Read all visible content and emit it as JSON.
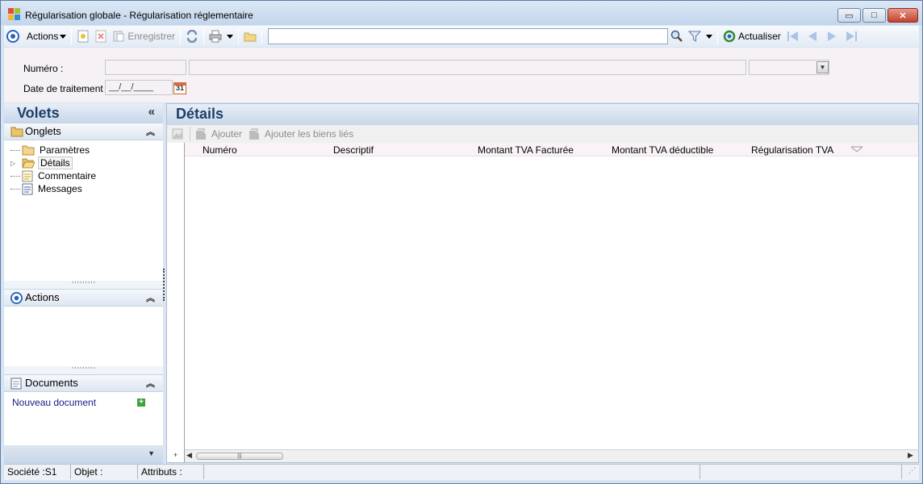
{
  "window": {
    "title": "Régularisation globale - Régularisation réglementaire",
    "controls": {
      "minimize": "▭",
      "maximize": "□",
      "close": "✕"
    }
  },
  "toolbar": {
    "actions_label": "Actions",
    "save_label": "Enregistrer",
    "search_placeholder": "",
    "refresh_label": "Actualiser"
  },
  "form": {
    "numero_label": "Numéro :",
    "date_label": "Date de traitement :",
    "date_value": "__/__/____",
    "calendar_day": "31"
  },
  "left_panel": {
    "title": "Volets",
    "collapse_glyph": "«",
    "tabs_section": {
      "title": "Onglets",
      "items": [
        {
          "label": "Paramètres",
          "icon": "folder-icon"
        },
        {
          "label": "Détails",
          "icon": "folder-open-icon",
          "selected": true
        },
        {
          "label": "Commentaire",
          "icon": "document-icon"
        },
        {
          "label": "Messages",
          "icon": "document-icon"
        }
      ]
    },
    "actions_section": {
      "title": "Actions"
    },
    "documents_section": {
      "title": "Documents",
      "new_document_label": "Nouveau document"
    }
  },
  "details": {
    "title": "Détails",
    "add_label": "Ajouter",
    "add_linked_label": "Ajouter les biens liés",
    "columns": [
      "Numéro",
      "Descriptif",
      "Montant TVA Facturée",
      "Montant TVA déductible",
      "Régularisation TVA"
    ],
    "rows": []
  },
  "statusbar": {
    "company": "Société :S1",
    "object": "Objet :",
    "attributes": "Attributs :"
  },
  "colors": {
    "frame": "#5e7ca3",
    "panel_title": "#1f3f6a",
    "link": "#16208a"
  }
}
